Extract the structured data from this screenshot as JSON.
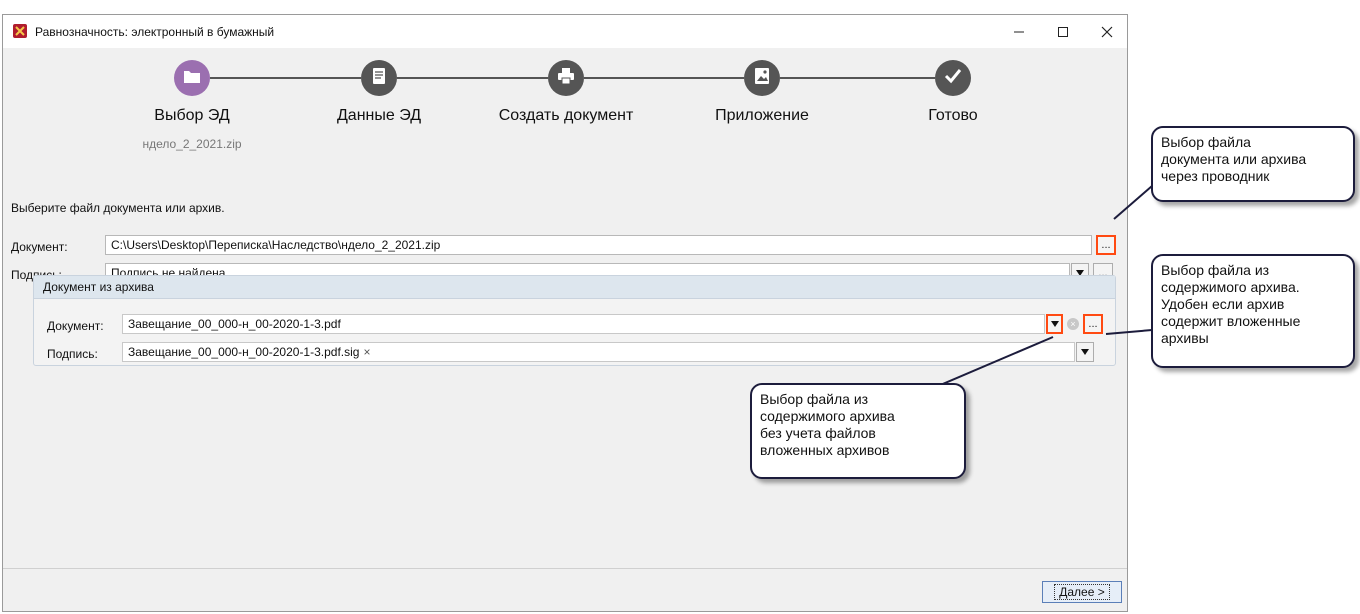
{
  "window": {
    "title": "Равнозначность: электронный в бумажный"
  },
  "wizard": {
    "steps": [
      {
        "label": "Выбор ЭД",
        "sublabel": "ндело_2_2021.zip",
        "icon": "folder-icon"
      },
      {
        "label": "Данные ЭД",
        "icon": "document-icon"
      },
      {
        "label": "Создать документ",
        "icon": "printer-icon"
      },
      {
        "label": "Приложение",
        "icon": "image-icon"
      },
      {
        "label": "Готово",
        "icon": "check-icon"
      }
    ]
  },
  "form": {
    "instruction": "Выберите файл документа или архив.",
    "document_label": "Документ:",
    "document_value": "C:\\Users\\Desktop\\Переписка\\Наследство\\ндело_2_2021.zip",
    "signature_label": "Подпись:",
    "signature_value": "Подпись не найдена",
    "browse_label": "...",
    "archive": {
      "title": "Документ из архива",
      "document_label": "Документ:",
      "document_value": "Завещание_00_000-н_00-2020-1-3.pdf",
      "signature_label": "Подпись:",
      "signature_value": "Завещание_00_000-н_00-2020-1-3.pdf.sig",
      "clear_glyph": "×"
    }
  },
  "footer": {
    "next_label": "Далее >"
  },
  "callouts": {
    "browse": "Выбор файла\nдокумента или архива\nчерез проводник",
    "archive_browse": "Выбор файла из\nсодержимого архива.\nУдобен если архив\nсодержит вложенные\nархивы",
    "archive_dropdown": "Выбор файла из\nсодержимого архива\nбез учета файлов\nвложенных архивов"
  },
  "colors": {
    "active_step": "#9b6fb0",
    "step": "#555555",
    "highlight": "#ff4a12",
    "accent": "#b01c2e"
  }
}
